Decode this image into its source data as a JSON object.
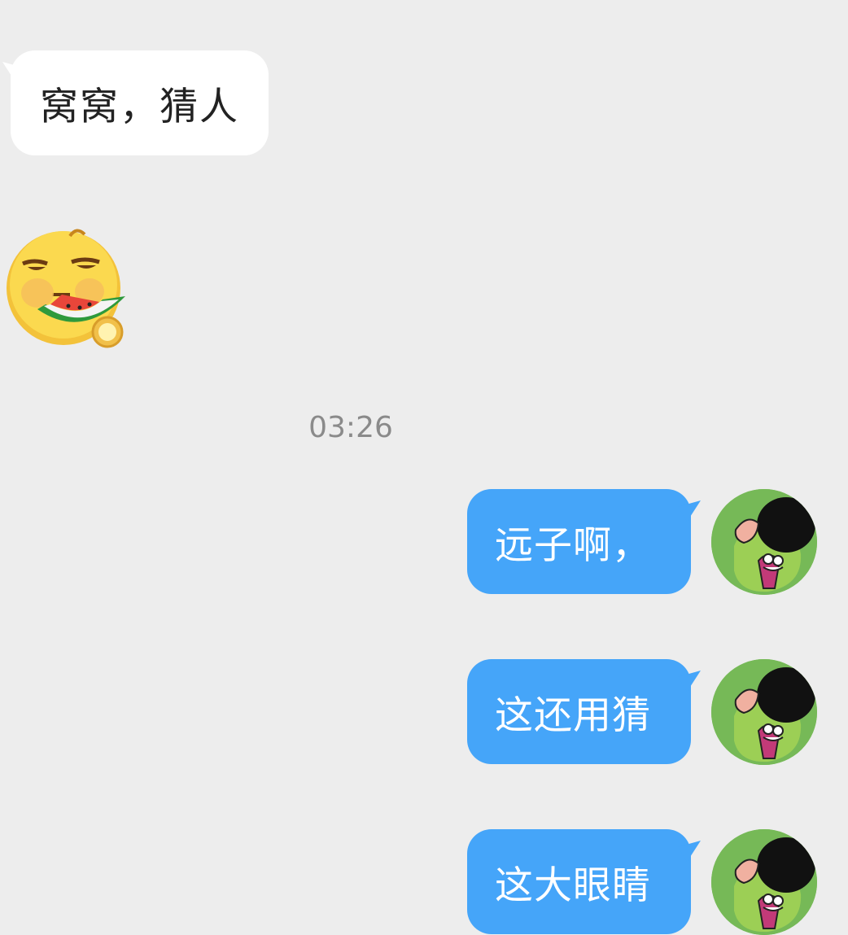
{
  "colors": {
    "background": "#ededed",
    "incoming_bubble": "#ffffff",
    "outgoing_bubble": "#45a5f9",
    "timestamp": "#8a8a8a"
  },
  "messages": [
    {
      "direction": "incoming",
      "type": "text",
      "text": "窝窝，猜人"
    },
    {
      "direction": "incoming",
      "type": "sticker",
      "icon": "watermelon-eating-emoji-icon"
    },
    {
      "type": "timestamp",
      "text": "03:26"
    },
    {
      "direction": "outgoing",
      "type": "text",
      "text": "远子啊，",
      "avatar_icon": "cartoon-avatar-icon"
    },
    {
      "direction": "outgoing",
      "type": "text",
      "text": "这还用猜",
      "avatar_icon": "cartoon-avatar-icon"
    },
    {
      "direction": "outgoing",
      "type": "text",
      "text": "这大眼睛",
      "avatar_icon": "cartoon-avatar-icon"
    }
  ]
}
